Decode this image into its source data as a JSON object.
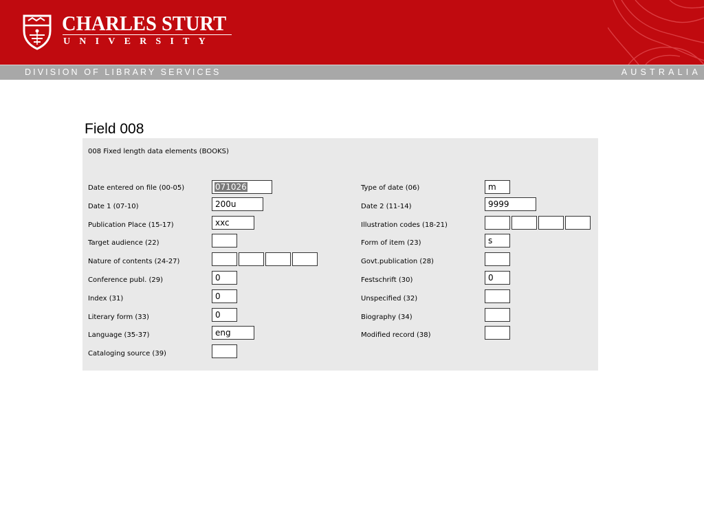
{
  "header": {
    "logo_name": "CHARLES STURT",
    "logo_sub": "UNIVERSITY",
    "division": "DIVISION OF LIBRARY SERVICES",
    "country": "AUSTRALIA"
  },
  "colors": {
    "brand_red": "#c00a0f",
    "bar_grey": "#a8a8a8",
    "panel_grey": "#e9e9e9"
  },
  "page": {
    "heading": "Field 008"
  },
  "panel": {
    "title": "008 Fixed length data elements (BOOKS)",
    "left": [
      {
        "label": "Date entered on file (00-05)",
        "values": [
          "071026"
        ]
      },
      {
        "label": "Date 1 (07-10)",
        "values": [
          "200u"
        ]
      },
      {
        "label": "Publication Place (15-17)",
        "values": [
          "xxc"
        ]
      },
      {
        "label": "Target audience (22)",
        "values": [
          ""
        ]
      },
      {
        "label": "Nature of contents (24-27)",
        "values": [
          "",
          "",
          "",
          ""
        ]
      },
      {
        "label": "Conference publ. (29)",
        "values": [
          "0"
        ]
      },
      {
        "label": "Index (31)",
        "values": [
          "0"
        ]
      },
      {
        "label": "Literary form (33)",
        "values": [
          "0"
        ]
      },
      {
        "label": "Language (35-37)",
        "values": [
          "eng"
        ]
      },
      {
        "label": "Cataloging source (39)",
        "values": [
          ""
        ]
      }
    ],
    "right": [
      {
        "label": "Type of date (06)",
        "values": [
          "m"
        ]
      },
      {
        "label": "Date 2 (11-14)",
        "values": [
          "9999"
        ]
      },
      {
        "label": "Illustration codes (18-21)",
        "values": [
          "",
          "",
          "",
          ""
        ]
      },
      {
        "label": "Form of item (23)",
        "values": [
          "s"
        ]
      },
      {
        "label": "Govt.publication (28)",
        "values": [
          ""
        ]
      },
      {
        "label": "Festschrift (30)",
        "values": [
          "0"
        ]
      },
      {
        "label": "Unspecified (32)",
        "values": [
          ""
        ]
      },
      {
        "label": "Biography (34)",
        "values": [
          ""
        ]
      },
      {
        "label": "Modified record (38)",
        "values": [
          ""
        ]
      }
    ]
  }
}
